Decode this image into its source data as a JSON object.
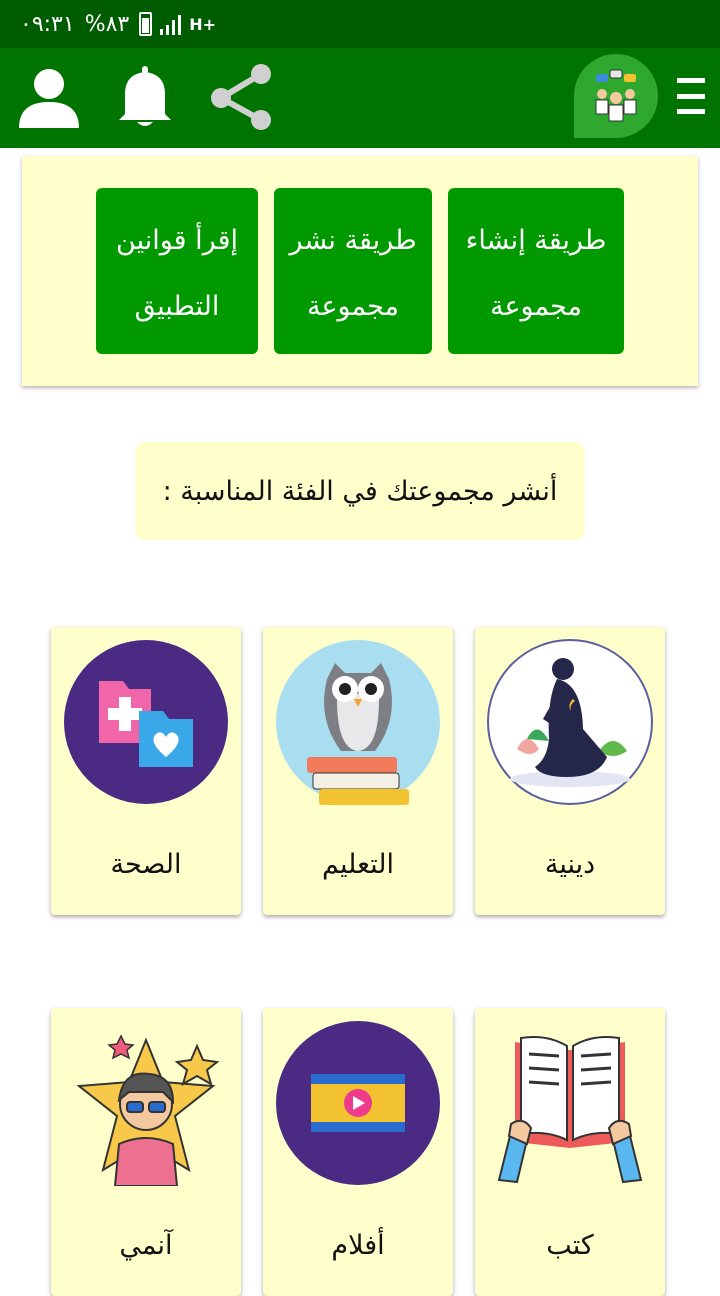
{
  "status_bar": {
    "time": "٠٩:٣١",
    "battery": "%٨٣",
    "network": "H+"
  },
  "app_bar": {
    "icons": [
      "menu-icon",
      "logo-icon",
      "share-icon",
      "bell-icon",
      "profile-icon"
    ]
  },
  "top_buttons": [
    {
      "line1": "طريقة إنشاء",
      "line2": "مجموعة"
    },
    {
      "line1": "طريقة نشر",
      "line2": "مجموعة"
    },
    {
      "line1": "إقرأ قوانين",
      "line2": "التطبيق"
    }
  ],
  "notice": "أنشر مجموعتك في الفئة المناسبة :",
  "categories": [
    {
      "label": "دينية",
      "icon": "prayer-icon"
    },
    {
      "label": "التعليم",
      "icon": "owl-books-icon"
    },
    {
      "label": "الصحة",
      "icon": "health-folders-icon"
    },
    {
      "label": "كتب",
      "icon": "open-book-icon"
    },
    {
      "label": "أفلام",
      "icon": "film-icon"
    },
    {
      "label": "آنمي",
      "icon": "anime-star-icon"
    }
  ],
  "colors": {
    "status_bar": "#005c00",
    "app_bar": "#007400",
    "button": "#009900",
    "card": "#ffffcc"
  }
}
